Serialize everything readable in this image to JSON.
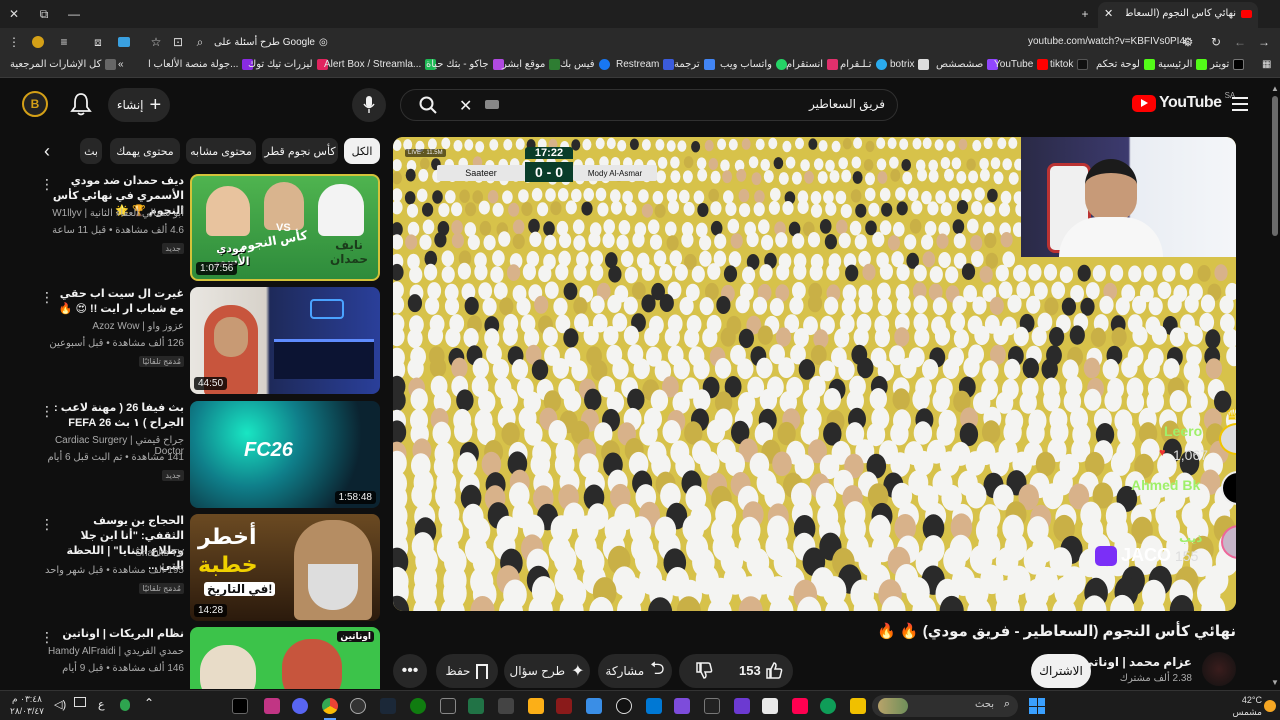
{
  "browser": {
    "tab_title": "نهائي كأس النجوم (السعاطير - فر",
    "url": "youtube.com/watch?v=KBFIVs0PI4c",
    "search_chip": "طرح أسئلة على Google",
    "bookmarks": [
      "تويتر",
      "الرئيسية",
      "لوحة تحكم",
      "tiktok",
      "YouTube",
      "صشصشص",
      "botrix",
      "تـلـقرام",
      "انستقرام",
      "واتساب ويب",
      "ترجمة",
      "Restream",
      "فيس بك",
      "موقع ابشر",
      "جاكو - بثك حياة",
      "Alert Box / Streamla...",
      "ليزرات تيك توك",
      "جولة منصة الألعاب ا...",
      "كل الإشارات المرجعية"
    ]
  },
  "header": {
    "logo_text": "YouTube",
    "logo_region": "SA",
    "search_value": "فريق السعاطير",
    "create_label": "إنشاء"
  },
  "chips": [
    "الكل",
    "كأس نجوم قطر",
    "محتوى مشابه",
    "محتوى يهمك",
    "بث"
  ],
  "recommended": [
    {
      "title": "ديف حمدان ضد مودي الأسمري في نهائي كأس النجوم 🏆 🌟",
      "channel": "أبو شمالي العفاء الثانية | W1llyv",
      "meta": "4.6 ألف مشاهدة • قبل 11 ساعة",
      "badge": "جديد",
      "duration": "1:07:56"
    },
    {
      "title": "غيرت ال سيت اب حقي مع شباب ار ايت !! 😍 🔥",
      "channel": "عزوز واو | Azoz Wow",
      "meta": "126 ألف مشاهدة • قبل أسبوعين",
      "badge": "مُدمَج تلقائيًا",
      "duration": "44:50"
    },
    {
      "title": "بث فيفا 26 ( مهنة لاعب : الجراح ) ١ بث FEFA 26",
      "channel": "جراح قيمتي | Cardiac Surgery Doctor",
      "meta": "141 مشاهدة • تم البث قبل 6 أيام",
      "badge": "جديد",
      "duration": "1:58:48"
    },
    {
      "title": "الحجاج بن يوسف الثقفي: \"أنا ابن جلا وطلاع الثنايا\" | اللحظة التي ...",
      "channel": "Shanks TV",
      "meta": "195 ألف مشاهدة • قبل شهر واحد",
      "badge": "مُدمَج تلقائيًا",
      "duration": "14:28"
    },
    {
      "title": "نظام البريكات | اوناتين",
      "channel": "حمدي الفريدي | Hamdy AlFraidi",
      "meta": "146 ألف مشاهدة • قبل 9 أيام",
      "badge": "",
      "duration": ""
    }
  ],
  "thumb_text": {
    "t1_vs": "VS",
    "t1_left": "مودي الأسمر",
    "t1_right": "نايف حمدان",
    "t1_mid": "كأس النجوم",
    "t3_logo": "FC26",
    "t4_line1": "أخطر",
    "t4_line2": "خطبة",
    "t4_line3": "في التاريخ!",
    "t5_logo": "اوناتين"
  },
  "player": {
    "scoreboard": {
      "time": "17:22",
      "team_left": "Saateer",
      "score": "0 - 0",
      "team_right": "Mody Al-Asmar",
      "live": "LIVE",
      "viewers": "11.5M"
    },
    "overlay": {
      "name1": "Leero",
      "count1": "1,067",
      "name2": "Ahmed Bk",
      "name3": "ذيب",
      "brand": "JACO",
      "count3": "155"
    }
  },
  "video": {
    "title": "نهائي كأس النجوم (السعاطير - فريق مودي) 🔥 🔥",
    "channel": "عزام محمد | اوناتي",
    "subs": "2.38 ألف مشترك",
    "subscribe": "الاشتراك",
    "likes": "153",
    "share": "مشاركة",
    "ask": "طرح سؤال",
    "save": "حفظ"
  },
  "taskbar": {
    "weather_temp": "42°C",
    "weather_desc": "مشمس",
    "search": "بحث",
    "time": "٠٣:٤٨ م",
    "date": "٢٨/٠٣/٤٧",
    "lang": "ع"
  },
  "colors": {
    "brand_red": "#ff0000",
    "bg": "#0f0f0f",
    "pill": "#272727",
    "chip_active": "#f1f1f1",
    "seat_yellow": "#d7c24a"
  }
}
